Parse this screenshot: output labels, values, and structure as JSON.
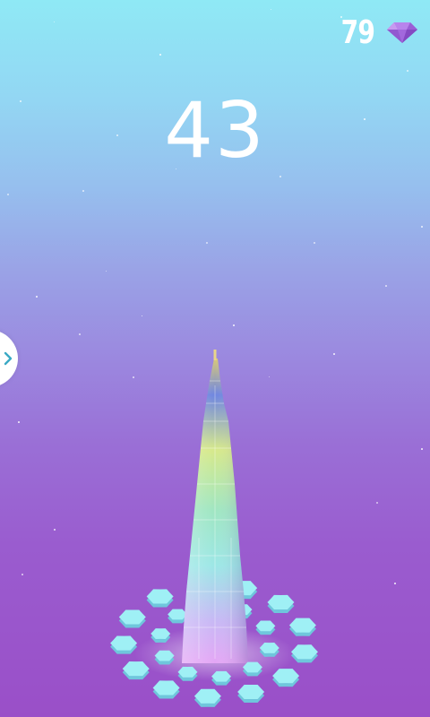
{
  "hud": {
    "score": "43",
    "gem_count": "79",
    "gem_icon": "purple-gem-icon",
    "side_tab_icon": "chevron-right-icon"
  },
  "colors": {
    "sky_top": "#8fe9f5",
    "sky_bottom": "#9a4fc8",
    "gem": "#a86fe0",
    "tile": "#9ff0f5",
    "text": "#ffffff"
  }
}
